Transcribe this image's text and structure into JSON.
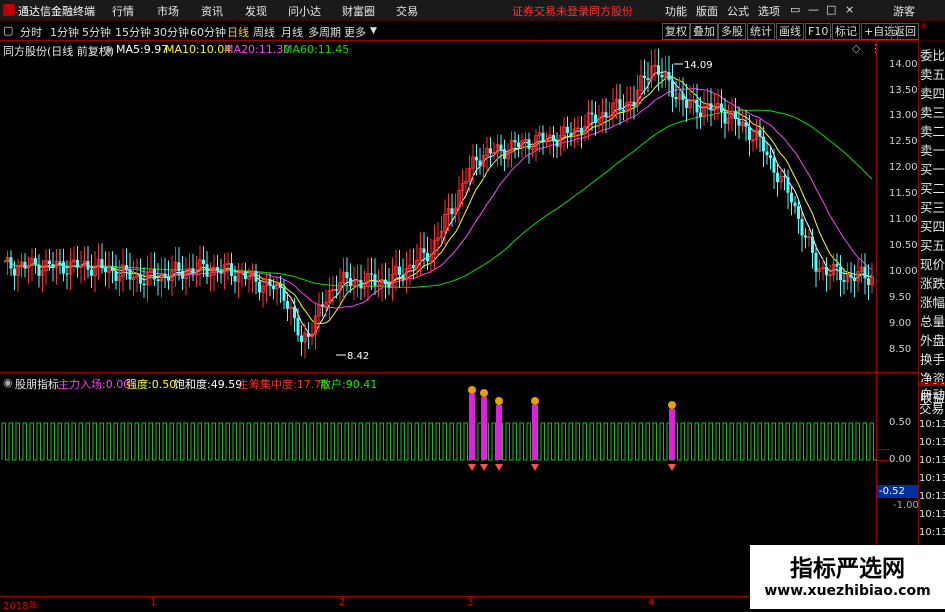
{
  "app": {
    "title": "通达信金融终端",
    "menu": [
      "行情",
      "市场",
      "资讯",
      "发现",
      "问小达",
      "财富圈",
      "交易"
    ],
    "status_text": "证券交易未登录",
    "stock_name_top": "同方股份",
    "menu_right": [
      "功能",
      "版面",
      "公式",
      "选项"
    ],
    "guest": "游客"
  },
  "periods": {
    "items": [
      "分时",
      "1分钟",
      "5分钟",
      "15分钟",
      "30分钟",
      "60分钟",
      "日线",
      "周线",
      "月线",
      "多周期",
      "更多"
    ],
    "active": "日线"
  },
  "toolbar_right": [
    "复权",
    "叠加",
    "多股",
    "统计",
    "画线",
    "F10",
    "标记",
    "+自选",
    "返回"
  ],
  "main_chart": {
    "title": "同方股份(日线 前复权)",
    "ma": [
      {
        "label": "MA5:",
        "value": "9.97",
        "color": "#ffffff"
      },
      {
        "label": "MA10:",
        "value": "10.04",
        "color": "#ffff00"
      },
      {
        "label": "MA20:",
        "value": "11.30",
        "color": "#ff40ff"
      },
      {
        "label": "MA60:",
        "value": "11.45",
        "color": "#00e000"
      }
    ],
    "high_label": "14.09",
    "low_label": "8.42",
    "y_ticks": [
      "14.00",
      "13.50",
      "13.00",
      "12.50",
      "12.00",
      "11.50",
      "11.00",
      "10.50",
      "10.00",
      "9.50",
      "9.00",
      "8.50"
    ]
  },
  "indicator": {
    "name": "股朋指标",
    "fields": [
      {
        "label": "主力入场:",
        "value": "0.00",
        "color": "#ff40ff"
      },
      {
        "label": "强度:",
        "value": "0.50",
        "color": "#ffff00"
      },
      {
        "label": "饱和度:",
        "value": "49.59",
        "color": "#ffffff"
      },
      {
        "label": "主筹集中度:",
        "value": "17.70",
        "color": "#ff3030"
      },
      {
        "label": "散户:",
        "value": "90.41",
        "color": "#00ff00"
      }
    ],
    "y_ticks": [
      "0.50",
      "0.00"
    ],
    "current_value": "-0.52"
  },
  "right_panel": {
    "items": [
      "委比",
      "卖五",
      "卖四",
      "卖三",
      "卖二",
      "卖一",
      "买一",
      "买二",
      "买三",
      "买四",
      "买五",
      "现价",
      "涨跌",
      "涨幅",
      "总量",
      "外盘",
      "换手",
      "净资",
      "收益"
    ],
    "lower_items": [
      "自动",
      "交易"
    ],
    "times": [
      "10:13",
      "10:13",
      "10:13",
      "10:13",
      "10:13",
      "10:13",
      "10:13",
      "10:13",
      "10:13"
    ],
    "extra_labels": [
      "-1.00"
    ]
  },
  "x_axis": [
    "2018年",
    "1",
    "2",
    "3",
    "4"
  ],
  "watermark": {
    "title": "指标严选网",
    "url": "www.xuezhibiao.com"
  },
  "colors": {
    "up": "#ff3232",
    "down": "#54fcfc",
    "panel_border": "#a00000"
  }
}
